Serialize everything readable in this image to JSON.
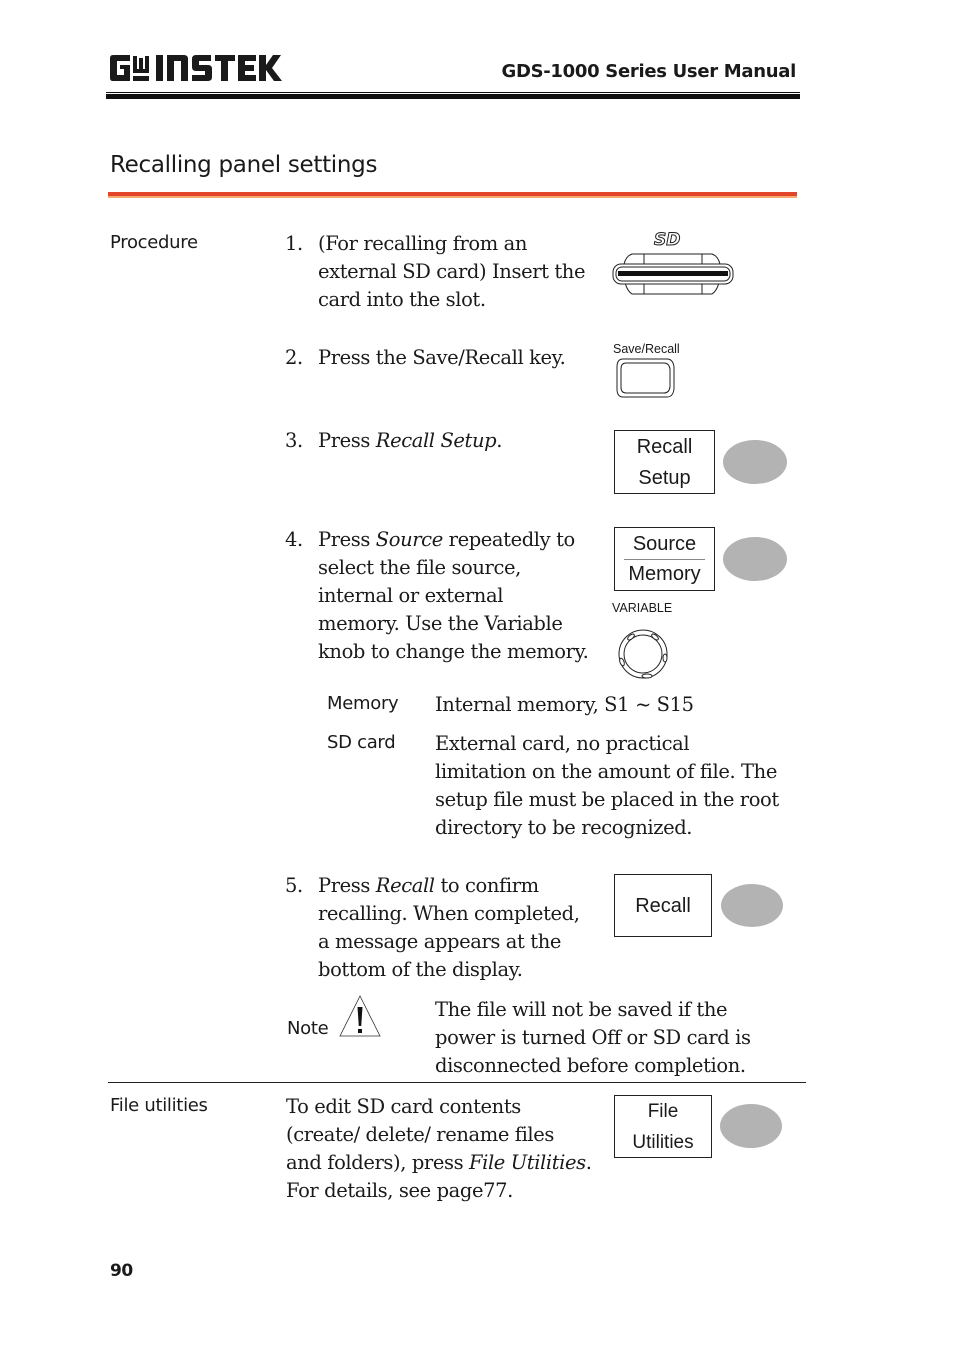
{
  "header": {
    "brand": "GW INSTEK",
    "manual_title": "GDS-1000 Series User Manual"
  },
  "section": {
    "title": "Recalling panel settings",
    "accent_color": "#e2452a"
  },
  "procedure": {
    "label": "Procedure",
    "steps": [
      {
        "number": "1.",
        "lines": [
          "(For recalling from an",
          "external SD card) Insert the",
          "card into the slot."
        ],
        "icon": "sd-card-slot-icon"
      },
      {
        "number": "2.",
        "text": "Press the Save/Recall key.",
        "key_label": "Save/Recall"
      },
      {
        "number": "3.",
        "prefix": "Press ",
        "emph": "Recall Setup",
        "suffix": ".",
        "softkey": [
          "Recall",
          "Setup"
        ]
      },
      {
        "number": "4.",
        "first_prefix": "Press ",
        "first_emph": "Source",
        "first_suffix": " repeatedly to",
        "lines": [
          "select the file source,",
          "internal or external",
          "memory. Use the Variable",
          "knob to change the memory."
        ],
        "softkey": {
          "top": "Source",
          "bottom": "Memory"
        },
        "knob_label": "VARIABLE",
        "options": [
          {
            "name": "Memory",
            "desc_lines": [
              "Internal memory, S1 ~ S15"
            ]
          },
          {
            "name": "SD card",
            "desc_lines": [
              "External card, no practical",
              "limitation on the amount of file. The",
              "setup file must be placed in the root",
              "directory to be recognized."
            ]
          }
        ]
      },
      {
        "number": "5.",
        "first_prefix": "Press ",
        "first_emph": "Recall",
        "first_suffix": " to confirm",
        "lines": [
          "recalling. When completed,",
          "a message appears at the",
          "bottom of the display."
        ],
        "softkey": "Recall"
      }
    ],
    "note": {
      "label": "Note",
      "lines": [
        "The file will not be saved if the",
        "power is turned Off or SD card is",
        "disconnected before completion."
      ]
    }
  },
  "file_utilities": {
    "label": "File utilities",
    "lines": [
      "To edit SD card contents",
      "(create/ delete/ rename files"
    ],
    "line3_prefix": "and folders), press ",
    "line3_emph": "File Utilities",
    "line3_suffix": ".",
    "line4": "For details, see page77.",
    "softkey": [
      "File",
      "Utilities"
    ]
  },
  "footer": {
    "page_number": "90"
  }
}
